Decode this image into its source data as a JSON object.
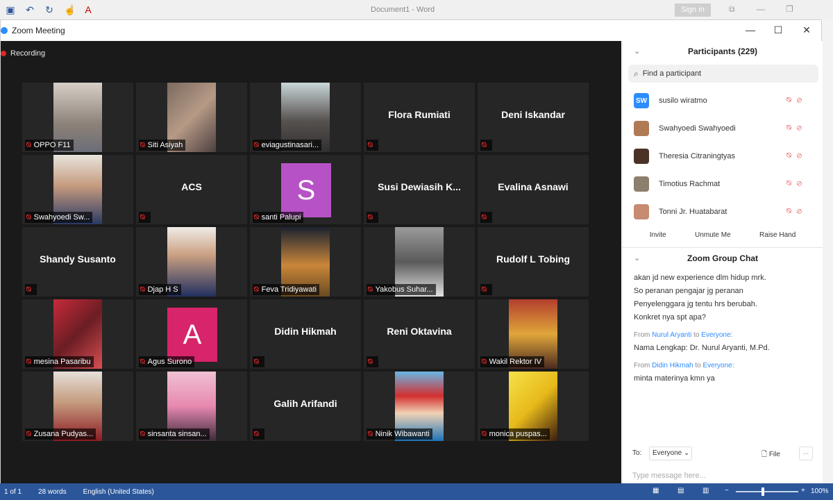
{
  "word": {
    "document_title": "Document1 - Word",
    "sign_in": "Sign in",
    "status": {
      "page": "1 of 1",
      "words": "28 words",
      "language": "English (United States)",
      "zoom": "100%"
    }
  },
  "zoom": {
    "window_title": "Zoom Meeting",
    "recording_label": "Recording",
    "tiles": [
      {
        "name": "OPPO F11",
        "kind": "photo",
        "ph": "ph-a"
      },
      {
        "name": "Siti Asiyah",
        "kind": "photo",
        "ph": "ph-b"
      },
      {
        "name": "eviagustinasari...",
        "kind": "photo",
        "ph": "ph-c"
      },
      {
        "name": "Flora Rumiati",
        "kind": "text"
      },
      {
        "name": "Deni Iskandar",
        "kind": "text"
      },
      {
        "name": "Swahyoedi Sw...",
        "kind": "photo",
        "ph": "ph-d"
      },
      {
        "name": "ACS",
        "kind": "text"
      },
      {
        "name": "santi Palupi",
        "kind": "avatar",
        "letter": "S",
        "color": "#b752c6"
      },
      {
        "name": "Susi Dewiasih K...",
        "kind": "text"
      },
      {
        "name": "Evalina Asnawi",
        "kind": "text"
      },
      {
        "name": "Shandy Susanto",
        "kind": "text"
      },
      {
        "name": "Djap H S",
        "kind": "photo",
        "ph": "ph-e"
      },
      {
        "name": "Feva Tridiyawati",
        "kind": "photo",
        "ph": "ph-f"
      },
      {
        "name": "Yakobus Suhar...",
        "kind": "photo",
        "ph": "ph-g"
      },
      {
        "name": "Rudolf L Tobing",
        "kind": "text"
      },
      {
        "name": "mesina Pasaribu",
        "kind": "photo",
        "ph": "ph-h"
      },
      {
        "name": "Agus Surono",
        "kind": "avatar",
        "letter": "A",
        "color": "#d8246a"
      },
      {
        "name": "Didin Hikmah",
        "kind": "text"
      },
      {
        "name": "Reni Oktavina",
        "kind": "text"
      },
      {
        "name": "Wakil Rektor IV",
        "kind": "photo",
        "ph": "ph-i"
      },
      {
        "name": "Zusana Pudyas...",
        "kind": "photo",
        "ph": "ph-j"
      },
      {
        "name": "sinsanta sinsan...",
        "kind": "photo",
        "ph": "ph-k"
      },
      {
        "name": "Galih Arifandi",
        "kind": "text"
      },
      {
        "name": "Ninik Wibawanti",
        "kind": "photo",
        "ph": "ph-l"
      },
      {
        "name": "monica puspas...",
        "kind": "photo",
        "ph": "ph-m"
      }
    ],
    "participants": {
      "title": "Participants (229)",
      "search_placeholder": "Find a participant",
      "list": [
        {
          "name": "susilo wiratmo",
          "initials": "SW",
          "color": "#2d8cff"
        },
        {
          "name": "Swahyoedi Swahyoedi",
          "initials": "",
          "color": "#b07a54"
        },
        {
          "name": "Theresia Citraningtyas",
          "initials": "",
          "color": "#4a3326"
        },
        {
          "name": "Timotius Rachmat",
          "initials": "",
          "color": "#8c7f6e"
        },
        {
          "name": "Tonni Jr. Huatabarat",
          "initials": "",
          "color": "#c68b70"
        }
      ],
      "buttons": [
        "Invite",
        "Unmute Me",
        "Raise Hand"
      ]
    },
    "chat": {
      "title": "Zoom Group Chat",
      "messages": [
        {
          "text": "akan jd new experience dlm hidup mrk."
        },
        {
          "text": "So peranan pengajar jg peranan"
        },
        {
          "text": "Penyelenggara jg tentu hrs berubah."
        },
        {
          "text": "Konkret nya spt apa?"
        }
      ],
      "from1": {
        "prefix": "From",
        "sender": "Nurul Aryanti",
        "mid": "to",
        "target": "Everyone:"
      },
      "msg1": "Nama Lengkap: Dr. Nurul Aryanti, M.Pd.",
      "from2": {
        "prefix": "From",
        "sender": "Didin Hikmah",
        "mid": "to",
        "target": "Everyone:"
      },
      "msg2": "minta materinya kmn ya",
      "to_label": "To:",
      "to_value": "Everyone",
      "file_label": "File",
      "more_label": "...",
      "input_placeholder": "Type message here..."
    }
  }
}
